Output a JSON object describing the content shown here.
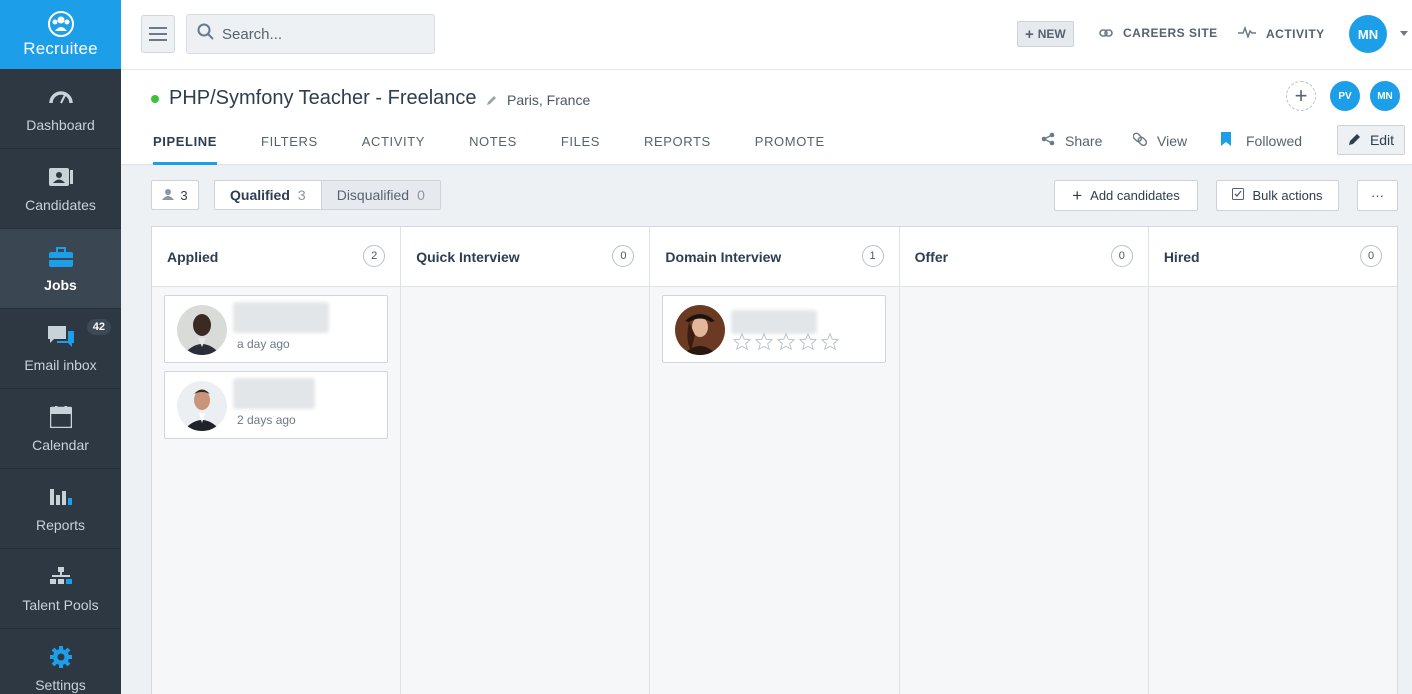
{
  "brand": {
    "name": "Recruitee",
    "color": "#1c9ee8"
  },
  "sidebar": {
    "items": [
      {
        "label": "Dashboard",
        "icon": "gauge-icon"
      },
      {
        "label": "Candidates",
        "icon": "candidate-card-icon"
      },
      {
        "label": "Jobs",
        "icon": "briefcase-icon",
        "active": true
      },
      {
        "label": "Email inbox",
        "icon": "chat-bubbles-icon",
        "badge": "42"
      },
      {
        "label": "Calendar",
        "icon": "calendar-icon"
      },
      {
        "label": "Reports",
        "icon": "bar-chart-icon"
      },
      {
        "label": "Talent Pools",
        "icon": "org-chart-icon"
      },
      {
        "label": "Settings",
        "icon": "gear-icon"
      }
    ]
  },
  "topbar": {
    "search_placeholder": "Search...",
    "new_label": "NEW",
    "careers_label": "CAREERS SITE",
    "activity_label": "ACTIVITY",
    "user_initials": "MN"
  },
  "job": {
    "title": "PHP/Symfony Teacher - Freelance",
    "location": "Paris, France",
    "status_color": "#3cc13b",
    "members": [
      "PV",
      "MN"
    ],
    "tabs": [
      "PIPELINE",
      "FILTERS",
      "ACTIVITY",
      "NOTES",
      "FILES",
      "REPORTS",
      "PROMOTE"
    ],
    "active_tab": "PIPELINE",
    "actions": {
      "share": "Share",
      "view": "View",
      "followed": "Followed",
      "edit": "Edit"
    }
  },
  "pipeline": {
    "candidate_count": "3",
    "qualified_label": "Qualified",
    "qualified_count": "3",
    "disqualified_label": "Disqualified",
    "disqualified_count": "0",
    "add_candidates": "Add candidates",
    "bulk_actions": "Bulk actions",
    "more": "···",
    "stages": [
      {
        "name": "Applied",
        "count": "2"
      },
      {
        "name": "Quick Interview",
        "count": "0"
      },
      {
        "name": "Domain Interview",
        "count": "1"
      },
      {
        "name": "Offer",
        "count": "0"
      },
      {
        "name": "Hired",
        "count": "0"
      }
    ],
    "cards": {
      "applied": [
        {
          "time": "a day ago"
        },
        {
          "time": "2 days ago"
        }
      ],
      "domain_interview": [
        {
          "rating": 0,
          "max_rating": 5
        }
      ]
    }
  }
}
